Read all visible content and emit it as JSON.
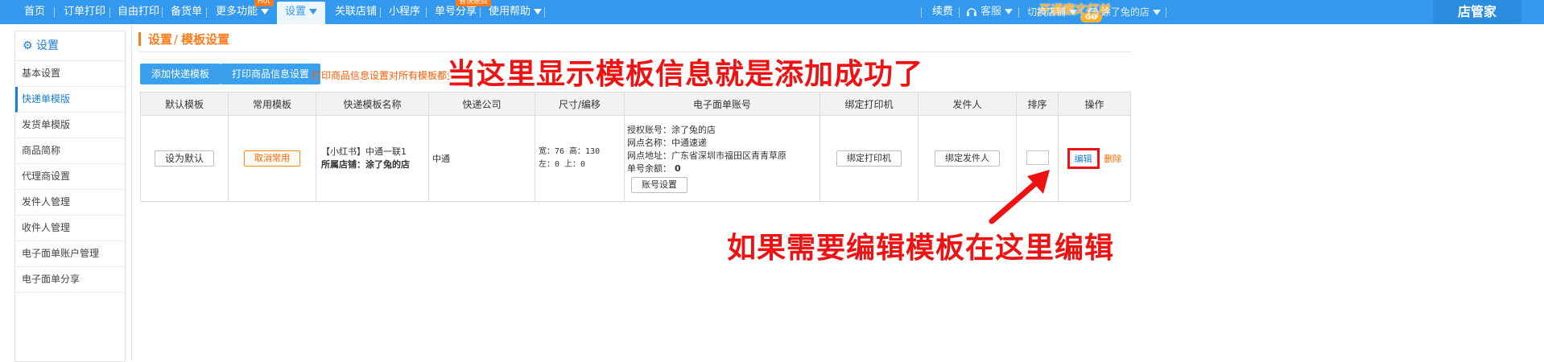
{
  "nav": {
    "items": [
      "首页",
      "订单打印",
      "自由打印",
      "备货单",
      "更多功能",
      "设置",
      "关联店铺",
      "小程序",
      "单号分享",
      "使用帮助"
    ],
    "badges": {
      "more": "Hot",
      "share": "省快递费",
      "customer": "客服"
    },
    "promo": {
      "text": "开通密文打单",
      "go": "GO"
    },
    "renew": "续费",
    "customer_service": "客服",
    "switch_shop": "切换店铺",
    "shop_name": "涂了兔的店",
    "brand": "店管家"
  },
  "sidebar": {
    "title": "设置",
    "items": [
      "基本设置",
      "快递单模版",
      "发货单模版",
      "商品简称",
      "代理商设置",
      "发件人管理",
      "收件人管理",
      "电子面单账户管理",
      "电子面单分享"
    ]
  },
  "breadcrumb": {
    "root": "设置",
    "sep": "/",
    "current": "模板设置"
  },
  "toolbar": {
    "add_template": "添加快递模板",
    "product_info": "打印商品信息设置",
    "hint": "打印商品信息设置对所有模板都生效"
  },
  "annotations": {
    "top": "当这里显示模板信息就是添加成功了",
    "bottom": "如果需要编辑模板在这里编辑"
  },
  "table": {
    "headers": [
      "默认模板",
      "常用模板",
      "快递模板名称",
      "快递公司",
      "尺寸/编移",
      "电子面单账号",
      "绑定打印机",
      "发件人",
      "排序",
      "操作"
    ],
    "row": {
      "set_default": "设为默认",
      "cancel_common": "取消常用",
      "template_name": "【小红书】中通一联1",
      "shop_label": "所属店铺：涂了兔的店",
      "company": "中通",
      "size_line1": "宽：76 高：130",
      "size_line2": "左：0 上：0",
      "account_line1": "授权账号：涂了兔的店",
      "account_line2": "网点名称：中通速递",
      "account_line3": "网点地址：广东省深圳市福田区青青草原",
      "balance_label": "单号余额：",
      "balance_value": "0",
      "account_settings": "账号设置",
      "bind_printer": "绑定打印机",
      "bind_sender": "绑定发件人",
      "edit": "编辑",
      "delete": "删除"
    }
  },
  "colors": {
    "nav": "#3399ee",
    "accent": "#ff7a1a",
    "annotation": "#ee1212",
    "link": "#1a7fd6"
  }
}
